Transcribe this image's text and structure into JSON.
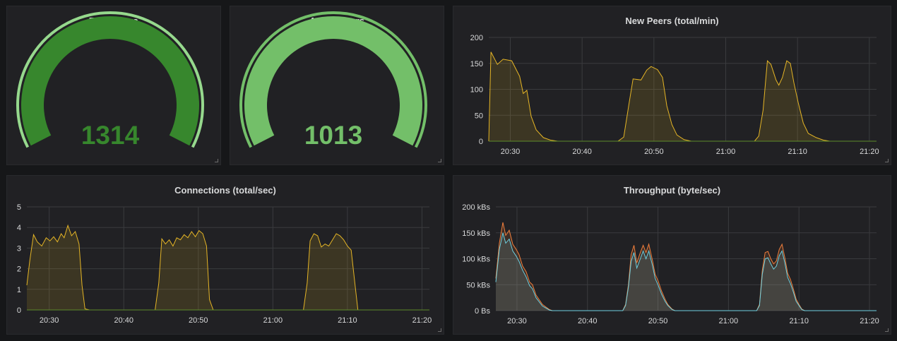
{
  "colors": {
    "gauge_total_fill": "#37872d",
    "gauge_total_text": "#37872d",
    "gauge_total_ring": "#96d98d",
    "gauge_active_fill": "#73bf69",
    "gauge_active_text": "#73bf69",
    "gauge_active_ring": "#73bf69",
    "series_yellow": "#e5b526",
    "series_green": "#5d8b2a",
    "series_orange": "#f07e3c",
    "series_blue": "#6ed0e0",
    "grid": "#3a3b3e"
  },
  "icons": [
    "resize-handle-icon"
  ],
  "chart_data": [
    {
      "id": "total_peers",
      "type": "gauge",
      "title": "Total Peers",
      "value": "1314",
      "fill_fraction": 1.0
    },
    {
      "id": "active_peers",
      "type": "gauge",
      "title": "Active Peers",
      "value": "1013",
      "fill_fraction": 1.0
    },
    {
      "id": "new_peers",
      "type": "area",
      "title": "New Peers (total/min)",
      "x_ticks": [
        "20:30",
        "20:40",
        "20:50",
        "21:00",
        "21:10",
        "21:20"
      ],
      "x_range_min": [
        27,
        81
      ],
      "y_ticks": [
        "0",
        "50",
        "100",
        "150",
        "200"
      ],
      "ylim": [
        0,
        200
      ],
      "series": [
        {
          "color_key": "series_yellow",
          "points": [
            [
              27,
              0
            ],
            [
              27.3,
              172
            ],
            [
              28.2,
              148
            ],
            [
              29,
              158
            ],
            [
              30.2,
              155
            ],
            [
              31.3,
              125
            ],
            [
              31.8,
              92
            ],
            [
              32.3,
              98
            ],
            [
              32.9,
              48
            ],
            [
              33.6,
              22
            ],
            [
              34.6,
              7
            ],
            [
              35.6,
              2
            ],
            [
              36.6,
              0
            ],
            [
              45,
              0
            ],
            [
              45.8,
              8
            ],
            [
              46.5,
              70
            ],
            [
              47.1,
              120
            ],
            [
              48.2,
              118
            ],
            [
              49,
              137
            ],
            [
              49.6,
              144
            ],
            [
              50.5,
              138
            ],
            [
              51.2,
              123
            ],
            [
              51.8,
              68
            ],
            [
              52.5,
              32
            ],
            [
              53.2,
              12
            ],
            [
              54.2,
              3
            ],
            [
              55.2,
              0
            ],
            [
              64,
              0
            ],
            [
              64.6,
              10
            ],
            [
              65.2,
              60
            ],
            [
              65.8,
              155
            ],
            [
              66.3,
              148
            ],
            [
              67,
              118
            ],
            [
              67.4,
              108
            ],
            [
              67.9,
              123
            ],
            [
              68.5,
              155
            ],
            [
              69,
              150
            ],
            [
              69.5,
              112
            ],
            [
              70.1,
              74
            ],
            [
              70.8,
              35
            ],
            [
              71.5,
              15
            ],
            [
              72.6,
              7
            ],
            [
              73.6,
              2
            ],
            [
              74.5,
              0
            ],
            [
              81,
              0
            ]
          ]
        },
        {
          "color_key": "series_green",
          "points": [
            [
              27,
              0
            ],
            [
              81,
              0
            ]
          ]
        }
      ]
    },
    {
      "id": "connections",
      "type": "area",
      "title": "Connections (total/sec)",
      "x_ticks": [
        "20:30",
        "20:40",
        "20:50",
        "21:00",
        "21:10",
        "21:20"
      ],
      "x_range_min": [
        27,
        81
      ],
      "y_ticks": [
        "0",
        "1",
        "2",
        "3",
        "4",
        "5"
      ],
      "ylim": [
        0,
        5
      ],
      "series": [
        {
          "color_key": "series_yellow",
          "points": [
            [
              27,
              1.2
            ],
            [
              27.4,
              2.4
            ],
            [
              27.9,
              3.65
            ],
            [
              28.4,
              3.3
            ],
            [
              29,
              3.1
            ],
            [
              29.6,
              3.5
            ],
            [
              30.1,
              3.35
            ],
            [
              30.6,
              3.55
            ],
            [
              31.1,
              3.3
            ],
            [
              31.6,
              3.7
            ],
            [
              32,
              3.5
            ],
            [
              32.5,
              4.1
            ],
            [
              33,
              3.6
            ],
            [
              33.5,
              3.8
            ],
            [
              34,
              3.2
            ],
            [
              34.4,
              1.2
            ],
            [
              34.8,
              0.05
            ],
            [
              35.4,
              0
            ],
            [
              44.2,
              0
            ],
            [
              44.7,
              1.3
            ],
            [
              45.1,
              3.45
            ],
            [
              45.6,
              3.2
            ],
            [
              46.1,
              3.4
            ],
            [
              46.6,
              3.1
            ],
            [
              47.1,
              3.5
            ],
            [
              47.6,
              3.4
            ],
            [
              48.1,
              3.65
            ],
            [
              48.6,
              3.5
            ],
            [
              49.1,
              3.8
            ],
            [
              49.6,
              3.55
            ],
            [
              50.1,
              3.85
            ],
            [
              50.6,
              3.7
            ],
            [
              51.1,
              3.1
            ],
            [
              51.5,
              0.5
            ],
            [
              52,
              0
            ],
            [
              64.1,
              0
            ],
            [
              64.6,
              1.3
            ],
            [
              65,
              3.35
            ],
            [
              65.5,
              3.7
            ],
            [
              66,
              3.6
            ],
            [
              66.5,
              3.05
            ],
            [
              67,
              3.2
            ],
            [
              67.5,
              3.1
            ],
            [
              68,
              3.4
            ],
            [
              68.5,
              3.7
            ],
            [
              69,
              3.6
            ],
            [
              69.5,
              3.4
            ],
            [
              70,
              3.1
            ],
            [
              70.5,
              2.9
            ],
            [
              71,
              1.3
            ],
            [
              71.4,
              0
            ],
            [
              81,
              0
            ]
          ]
        },
        {
          "color_key": "series_green",
          "points": [
            [
              27,
              0
            ],
            [
              81,
              0
            ]
          ]
        }
      ]
    },
    {
      "id": "throughput",
      "type": "area",
      "title": "Throughput (byte/sec)",
      "x_ticks": [
        "20:30",
        "20:40",
        "20:50",
        "21:00",
        "21:10",
        "21:20"
      ],
      "x_range_min": [
        27,
        81
      ],
      "y_ticks": [
        "0 Bs",
        "50 kBs",
        "100 kBs",
        "150 kBs",
        "200 kBs"
      ],
      "ylim": [
        0,
        200
      ],
      "series": [
        {
          "color_key": "series_orange",
          "points": [
            [
              27,
              62
            ],
            [
              27.5,
              130
            ],
            [
              28,
              170
            ],
            [
              28.4,
              145
            ],
            [
              28.9,
              155
            ],
            [
              29.4,
              128
            ],
            [
              29.9,
              118
            ],
            [
              30.3,
              108
            ],
            [
              30.8,
              86
            ],
            [
              31.3,
              75
            ],
            [
              31.8,
              55
            ],
            [
              32.2,
              50
            ],
            [
              32.7,
              30
            ],
            [
              33.1,
              22
            ],
            [
              33.6,
              12
            ],
            [
              34.1,
              7
            ],
            [
              34.6,
              2
            ],
            [
              35,
              0
            ],
            [
              45,
              0
            ],
            [
              45.4,
              12
            ],
            [
              45.8,
              50
            ],
            [
              46.2,
              108
            ],
            [
              46.6,
              126
            ],
            [
              47,
              92
            ],
            [
              47.5,
              112
            ],
            [
              47.9,
              126
            ],
            [
              48.3,
              112
            ],
            [
              48.7,
              128
            ],
            [
              49.2,
              98
            ],
            [
              49.6,
              70
            ],
            [
              50,
              58
            ],
            [
              50.5,
              38
            ],
            [
              51,
              22
            ],
            [
              51.4,
              12
            ],
            [
              52,
              3
            ],
            [
              52.4,
              0
            ],
            [
              64,
              0
            ],
            [
              64.4,
              12
            ],
            [
              64.8,
              78
            ],
            [
              65.2,
              112
            ],
            [
              65.6,
              114
            ],
            [
              66,
              100
            ],
            [
              66.4,
              90
            ],
            [
              66.8,
              96
            ],
            [
              67.2,
              118
            ],
            [
              67.6,
              128
            ],
            [
              68,
              102
            ],
            [
              68.4,
              72
            ],
            [
              68.8,
              60
            ],
            [
              69.2,
              42
            ],
            [
              69.6,
              22
            ],
            [
              70,
              12
            ],
            [
              70.4,
              3
            ],
            [
              70.8,
              0
            ],
            [
              81,
              0
            ]
          ]
        },
        {
          "color_key": "series_blue",
          "points": [
            [
              27,
              55
            ],
            [
              27.5,
              118
            ],
            [
              28,
              150
            ],
            [
              28.4,
              130
            ],
            [
              28.9,
              138
            ],
            [
              29.4,
              115
            ],
            [
              29.9,
              105
            ],
            [
              30.3,
              95
            ],
            [
              30.8,
              78
            ],
            [
              31.3,
              65
            ],
            [
              31.8,
              48
            ],
            [
              32.2,
              42
            ],
            [
              32.7,
              25
            ],
            [
              33.1,
              18
            ],
            [
              33.6,
              9
            ],
            [
              34.1,
              5
            ],
            [
              34.6,
              1
            ],
            [
              35,
              0
            ],
            [
              45,
              0
            ],
            [
              45.4,
              10
            ],
            [
              45.8,
              45
            ],
            [
              46.2,
              95
            ],
            [
              46.6,
              112
            ],
            [
              47,
              82
            ],
            [
              47.5,
              100
            ],
            [
              47.9,
              115
            ],
            [
              48.3,
              100
            ],
            [
              48.7,
              115
            ],
            [
              49.2,
              88
            ],
            [
              49.6,
              62
            ],
            [
              50,
              50
            ],
            [
              50.5,
              32
            ],
            [
              51,
              18
            ],
            [
              51.4,
              10
            ],
            [
              52,
              2
            ],
            [
              52.4,
              0
            ],
            [
              64,
              0
            ],
            [
              64.4,
              10
            ],
            [
              64.8,
              70
            ],
            [
              65.2,
              100
            ],
            [
              65.6,
              102
            ],
            [
              66,
              90
            ],
            [
              66.4,
              80
            ],
            [
              66.8,
              86
            ],
            [
              67.2,
              106
            ],
            [
              67.6,
              115
            ],
            [
              68,
              92
            ],
            [
              68.4,
              64
            ],
            [
              68.8,
              52
            ],
            [
              69.2,
              36
            ],
            [
              69.6,
              18
            ],
            [
              70,
              10
            ],
            [
              70.4,
              2
            ],
            [
              70.8,
              0
            ],
            [
              81,
              0
            ]
          ]
        }
      ]
    }
  ]
}
